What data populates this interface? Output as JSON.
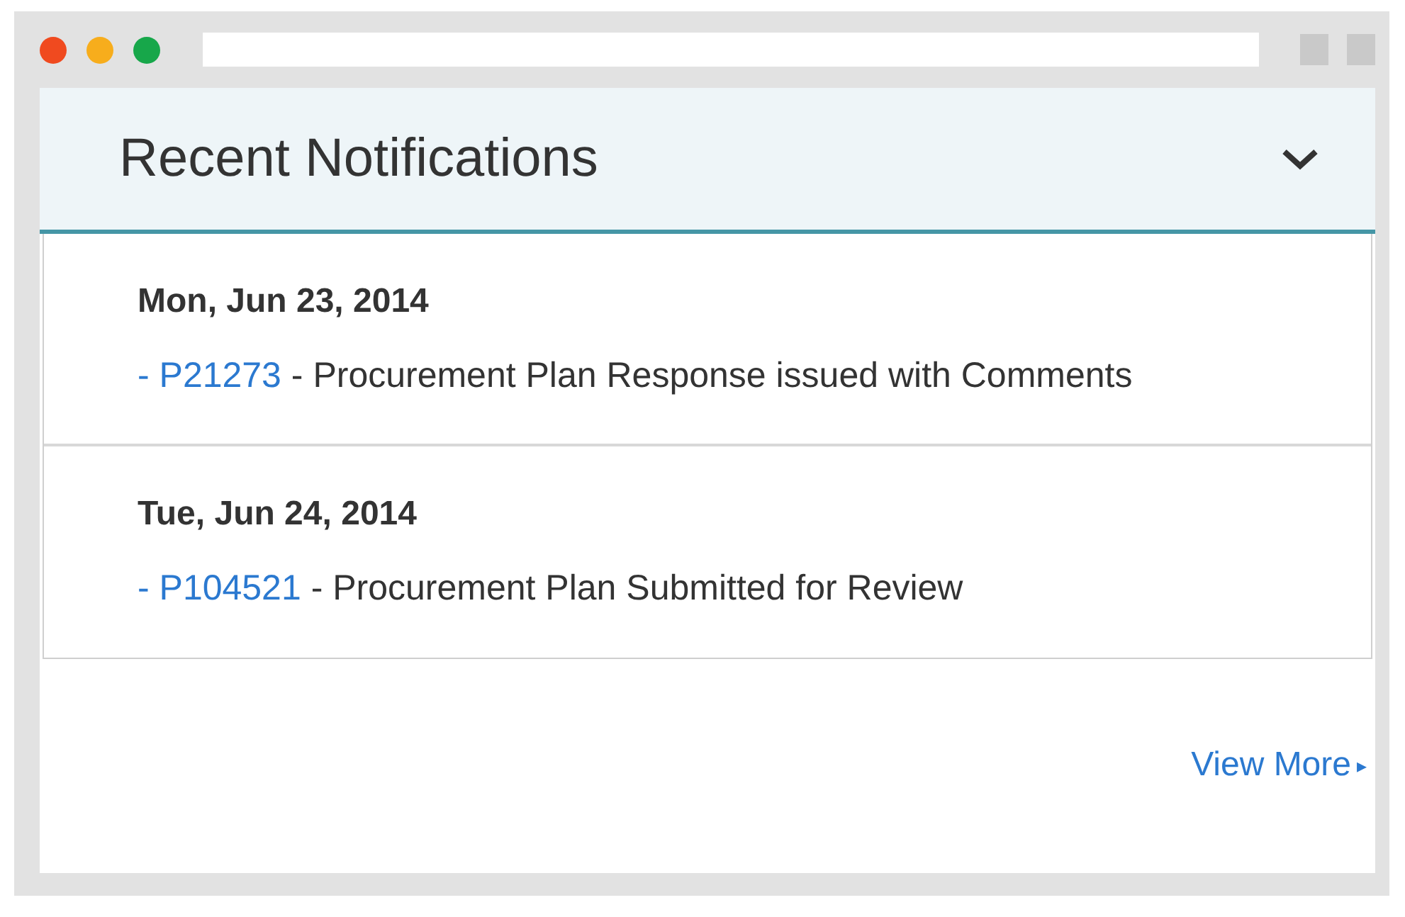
{
  "panel": {
    "title": "Recent Notifications",
    "expanded": true
  },
  "notifications": [
    {
      "date": "Mon, Jun 23, 2014",
      "id": "- P21273",
      "message": "- Procurement Plan Response issued with Comments"
    },
    {
      "date": "Tue, Jun 24, 2014",
      "id": "- P104521",
      "message": "- Procurement Plan Submitted for Review"
    }
  ],
  "footer": {
    "link": "View More",
    "arrow": "▸"
  }
}
